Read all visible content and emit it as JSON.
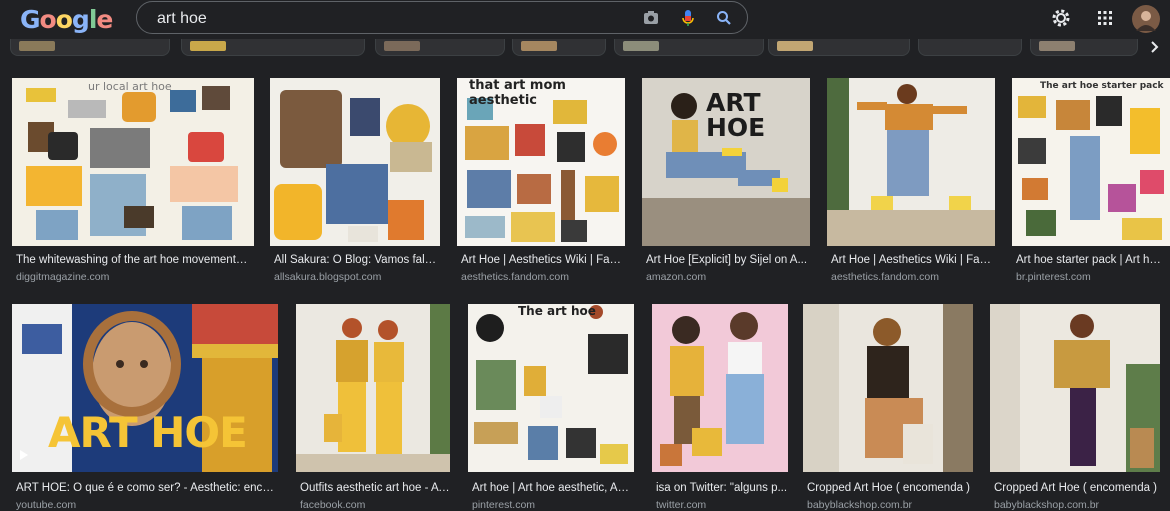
{
  "logo": [
    "G",
    "o",
    "o",
    "g",
    "l",
    "e"
  ],
  "search": {
    "value": "art hoe"
  },
  "icons": [
    "camera-icon",
    "microphone-icon",
    "search-icon",
    "settings-icon",
    "apps-icon",
    "avatar"
  ],
  "results_row1": [
    {
      "caption": "The whitewashing of the art hoe movement | ...",
      "source": "diggitmagazine.com",
      "overlay": "ur local art hoe"
    },
    {
      "caption": "All Sakura: O Blog: Vamos falar ...",
      "source": "allsakura.blogspot.com",
      "overlay": ""
    },
    {
      "caption": "Art Hoe | Aesthetics Wiki | Fan...",
      "source": "aesthetics.fandom.com",
      "overlay": "that art mom aesthetic"
    },
    {
      "caption": "Art Hoe [Explicit] by Sijel on A...",
      "source": "amazon.com",
      "overlay": "ART HOE"
    },
    {
      "caption": "Art Hoe | Aesthetics Wiki | Fan...",
      "source": "aesthetics.fandom.com",
      "overlay": ""
    },
    {
      "caption": "Art hoe starter pack | Art hoe ...",
      "source": "br.pinterest.com",
      "overlay": "The art hoe starter pack"
    }
  ],
  "results_row2": [
    {
      "caption": "ART HOE: O que é e como ser? - Aesthetic: encontr...",
      "source": "youtube.com",
      "overlay": "ART HOE"
    },
    {
      "caption": "Outfits aesthetic art hoe - A ...",
      "source": "facebook.com",
      "overlay": ""
    },
    {
      "caption": "Art hoe | Art hoe aesthetic, Aes...",
      "source": "pinterest.com",
      "overlay": "The art hoe"
    },
    {
      "caption": "isa on Twitter: \"alguns p...",
      "source": "twitter.com",
      "overlay": ""
    },
    {
      "caption": "Cropped Art Hoe ( encomenda )",
      "source": "babyblackshop.com.br",
      "overlay": ""
    },
    {
      "caption": "Cropped Art Hoe ( encomenda )",
      "source": "babyblackshop.com.br",
      "overlay": ""
    }
  ],
  "colors": {
    "background": "#202124",
    "caption": "#e8eaed",
    "source": "#9aa0a6"
  }
}
